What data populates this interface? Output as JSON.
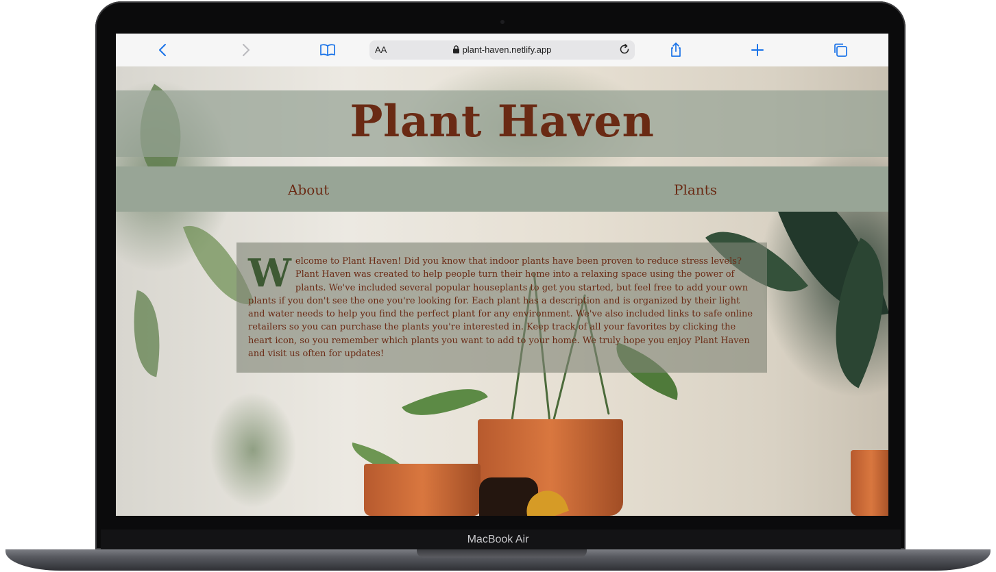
{
  "device": {
    "label": "MacBook Air"
  },
  "browser": {
    "aa_label": "AA",
    "url": "plant-haven.netlify.app",
    "icons": {
      "back": "chevron-left-icon",
      "forward": "chevron-right-icon",
      "bookmarks": "book-icon",
      "lock": "lock-icon",
      "reload": "reload-icon",
      "share": "share-icon",
      "new_tab": "plus-icon",
      "tabs": "tabs-icon"
    },
    "accent_color": "#1a73e8"
  },
  "site": {
    "title": "Plant Haven",
    "nav": [
      {
        "label": "About"
      },
      {
        "label": "Plants"
      }
    ],
    "intro": {
      "drop_cap": "W",
      "text": "elcome to Plant Haven! Did you know that indoor plants have been proven to reduce stress levels? Plant Haven was created to help people turn their home into a relaxing space using the power of plants. We've included several popular houseplants to get you started, but feel free to add your own plants if you don't see the one you're looking for. Each plant has a description and is organized by their light and water needs to help you find the perfect plant for any environment. We've also included links to safe online retailers so you can purchase the plants you're interested in. Keep track of all your favorites by clicking the heart icon, so you remember which plants you want to add to your home. We truly hope you enjoy Plant Haven and visit us often for updates!"
    },
    "colors": {
      "title_text": "#6a2a14",
      "drop_cap": "#3e5a34",
      "nav_band": "#98a596"
    }
  }
}
